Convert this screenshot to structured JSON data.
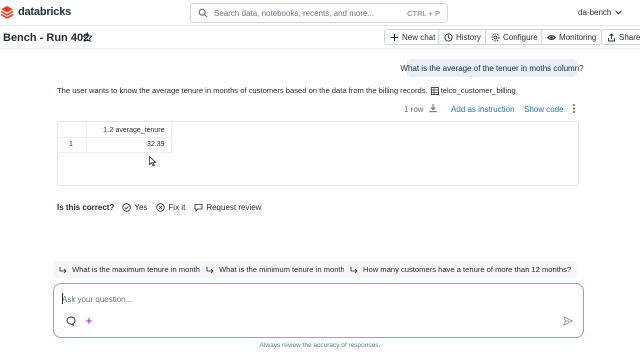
{
  "app": {
    "brand": "databricks",
    "brand_color": "#ff3621",
    "accent_color": "#2272b4"
  },
  "search": {
    "placeholder": "Search data, notebooks, recents, and more...",
    "shortcut": "CTRL + P"
  },
  "user": {
    "workspace": "da-bench"
  },
  "header": {
    "title": "Bench - Run 402",
    "buttons": {
      "new_chat": "New chat",
      "history": "History",
      "configure": "Configure",
      "monitoring": "Monitoring",
      "share": "Share"
    }
  },
  "chat": {
    "user_message": "What is the average of the tenuer in moths column?",
    "answer_text": "The user wants to know the average tenure in months of customers based on the data from the billing records.",
    "table_ref": "telco_customer_billing",
    "result_meta": {
      "rows": "1 row",
      "add_instruction": "Add as instruction",
      "show_code": "Show code"
    },
    "result_table": {
      "column_type": "1.2",
      "column_name": "average_tenure",
      "rows": [
        {
          "index": "1",
          "value": "32.39"
        }
      ]
    },
    "feedback": {
      "question": "Is this correct?",
      "yes": "Yes",
      "fix_it": "Fix it",
      "request_review": "Request review"
    },
    "suggestions": [
      "What is the maximum tenure in months?",
      "What is the minimum tenure in months?",
      "How many customers have a tenure of more than 12 months?"
    ]
  },
  "composer": {
    "placeholder": "Ask your question...",
    "value": ""
  },
  "footer": {
    "disclaimer": "Always review the accuracy of responses."
  },
  "icons": [
    "databricks-logo-icon",
    "search-icon",
    "chevron-down-icon",
    "star-icon",
    "plus-icon",
    "history-icon",
    "gear-icon",
    "eye-icon",
    "share-icon",
    "table-icon",
    "download-icon",
    "kebab-menu-icon",
    "cursor-icon",
    "check-circle-icon",
    "wrench-icon",
    "chat-bubble-icon",
    "arrow-return-icon",
    "comment-icon",
    "sparkle-icon",
    "send-icon"
  ]
}
